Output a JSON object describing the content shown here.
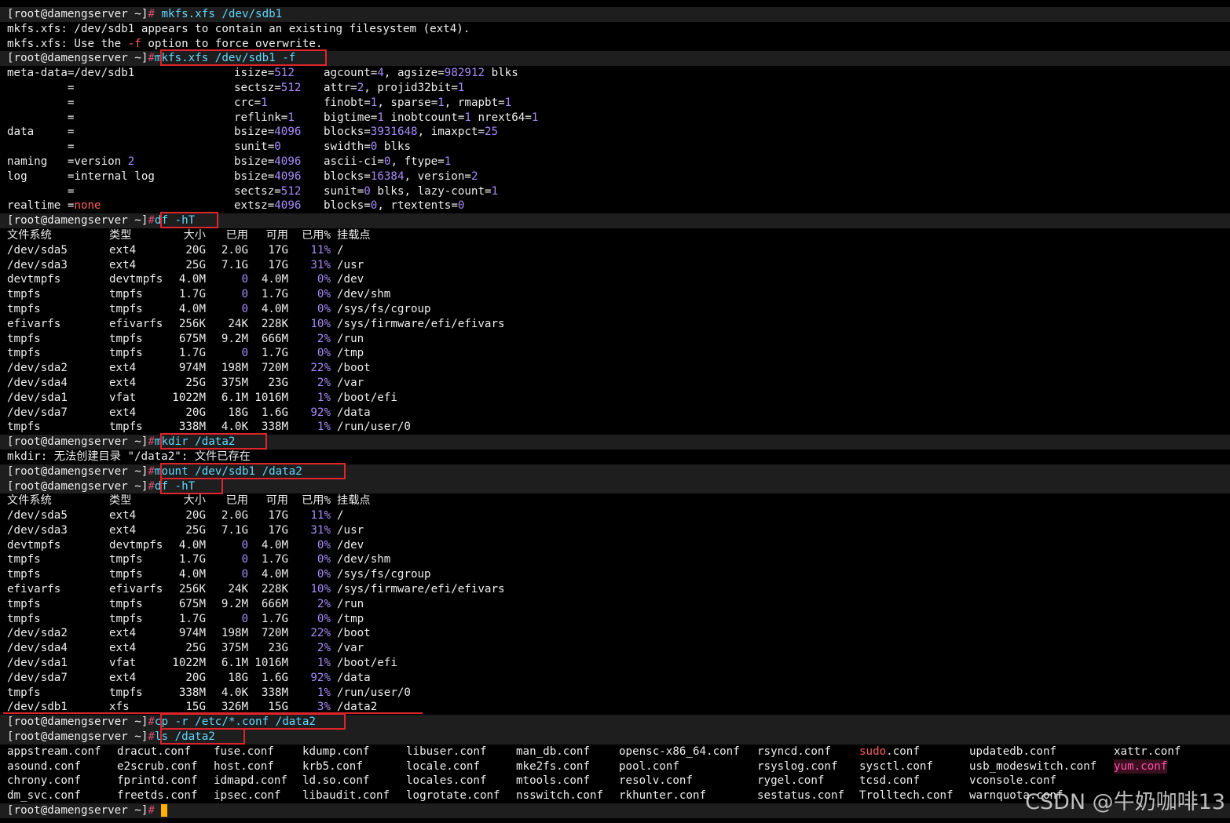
{
  "prompt": "[root@damengserver ~]",
  "hash": "#",
  "lines": {
    "l1_cmd": " mkfs.xfs /dev/sdb1",
    "l2": "mkfs.xfs: /dev/sdb1 appears to contain an existing filesystem (ext4).",
    "l3a": "mkfs.xfs: Use the ",
    "l3b": "-f",
    "l3c": " option to force overwrite.",
    "l4_cmd": "mkfs.xfs /dev/sdb1 -f",
    "md": [
      {
        "c1": "meta-data=/dev/sdb1",
        "c2k": "isize=",
        "c2v": "512",
        "c3": "agcount=4, agsize=982912 blks"
      },
      {
        "c1": "         =",
        "c2k": "sectsz=",
        "c2v": "512",
        "c3": "attr=2, projid32bit=1"
      },
      {
        "c1": "         =",
        "c2k": "crc=",
        "c2v": "1",
        "c3": "finobt=1, sparse=1, rmapbt=1"
      },
      {
        "c1": "         =",
        "c2k": "reflink=",
        "c2v": "1",
        "c3": "bigtime=1 inobtcount=1 nrext64=1"
      },
      {
        "c1": "data     =",
        "c2k": "bsize=",
        "c2v": "4096",
        "c3": "blocks=3931648, imaxpct=25"
      },
      {
        "c1": "         =",
        "c2k": "sunit=",
        "c2v": "0",
        "c3": "swidth=0 blks"
      },
      {
        "c1": "naming   =version 2",
        "c2k": "bsize=",
        "c2v": "4096",
        "c3": "ascii-ci=0, ftype=1"
      },
      {
        "c1": "log      =internal log",
        "c2k": "bsize=",
        "c2v": "4096",
        "c3": "blocks=16384, version=2"
      },
      {
        "c1": "         =",
        "c2k": "sectsz=",
        "c2v": "512",
        "c3": "sunit=0 blks, lazy-count=1"
      },
      {
        "c1": "realtime =none",
        "c2k": "extsz=",
        "c2v": "4096",
        "c3": "blocks=0, rtextents=0"
      }
    ],
    "df_cmd": "df -hT",
    "df_header": [
      "文件系统",
      "类型",
      "大小",
      "已用",
      "可用",
      "已用%",
      "挂载点"
    ],
    "df_rows": [
      [
        "/dev/sda5",
        "ext4",
        "20G",
        "2.0G",
        "17G",
        "11%",
        "/"
      ],
      [
        "/dev/sda3",
        "ext4",
        "25G",
        "7.1G",
        "17G",
        "31%",
        "/usr"
      ],
      [
        "devtmpfs",
        "devtmpfs",
        "4.0M",
        "0",
        "4.0M",
        "0%",
        "/dev"
      ],
      [
        "tmpfs",
        "tmpfs",
        "1.7G",
        "0",
        "1.7G",
        "0%",
        "/dev/shm"
      ],
      [
        "tmpfs",
        "tmpfs",
        "4.0M",
        "0",
        "4.0M",
        "0%",
        "/sys/fs/cgroup"
      ],
      [
        "efivarfs",
        "efivarfs",
        "256K",
        "24K",
        "228K",
        "10%",
        "/sys/firmware/efi/efivars"
      ],
      [
        "tmpfs",
        "tmpfs",
        "675M",
        "9.2M",
        "666M",
        "2%",
        "/run"
      ],
      [
        "tmpfs",
        "tmpfs",
        "1.7G",
        "0",
        "1.7G",
        "0%",
        "/tmp"
      ],
      [
        "/dev/sda2",
        "ext4",
        "974M",
        "198M",
        "720M",
        "22%",
        "/boot"
      ],
      [
        "/dev/sda4",
        "ext4",
        "25G",
        "375M",
        "23G",
        "2%",
        "/var"
      ],
      [
        "/dev/sda1",
        "vfat",
        "1022M",
        "6.1M",
        "1016M",
        "1%",
        "/boot/efi"
      ],
      [
        "/dev/sda7",
        "ext4",
        "20G",
        "18G",
        "1.6G",
        "92%",
        "/data"
      ],
      [
        "tmpfs",
        "tmpfs",
        "338M",
        "4.0K",
        "338M",
        "1%",
        "/run/user/0"
      ]
    ],
    "df_extra_row": [
      "/dev/sdb1",
      "xfs",
      "15G",
      "326M",
      "15G",
      "3%",
      "/data2"
    ],
    "mkdir_cmd": "mkdir /data2",
    "mkdir_err": "mkdir: 无法创建目录 \"/data2\": 文件已存在",
    "mount_cmd": "mount /dev/sdb1 /data2",
    "cp_cmd": "cp -r /etc/*.conf /data2",
    "ls_cmd": "ls /data2",
    "ls_rows": [
      [
        "appstream.conf",
        "dracut.conf",
        "fuse.conf",
        "kdump.conf",
        "libuser.conf",
        "man_db.conf",
        "opensc-x86_64.conf",
        "rsyncd.conf",
        "sudo.conf",
        "updatedb.conf",
        "xattr.conf"
      ],
      [
        "asound.conf",
        "e2scrub.conf",
        "host.conf",
        "krb5.conf",
        "locale.conf",
        "mke2fs.conf",
        "pool.conf",
        "rsyslog.conf",
        "sysctl.conf",
        "usb_modeswitch.conf",
        "yum.conf"
      ],
      [
        "chrony.conf",
        "fprintd.conf",
        "idmapd.conf",
        "ld.so.conf",
        "locales.conf",
        "mtools.conf",
        "resolv.conf",
        "rygel.conf",
        "tcsd.conf",
        "vconsole.conf",
        ""
      ],
      [
        "dm_svc.conf",
        "freetds.conf",
        "ipsec.conf",
        "libaudit.conf",
        "logrotate.conf",
        "nsswitch.conf",
        "rkhunter.conf",
        "sestatus.conf",
        "Trolltech.conf",
        "warnquota.conf",
        ""
      ]
    ]
  },
  "watermark": "CSDN @牛奶咖啡13",
  "colors": {
    "background": "#000000",
    "prompt_bg": "#1e1e1e",
    "command": "#5fd7ff",
    "number": "#a78bfa",
    "highlight_box": "#e0242b"
  }
}
